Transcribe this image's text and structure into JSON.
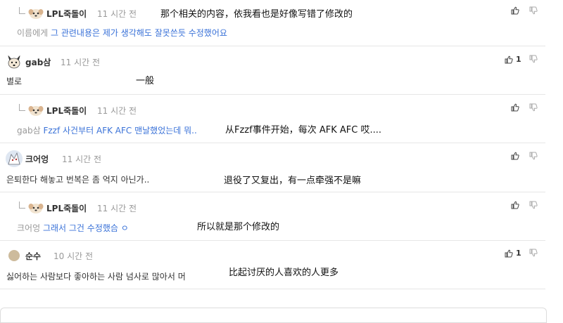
{
  "comments": [
    {
      "author": "LPL죽돌이",
      "time": "11 시간 전",
      "mention": "이름에게",
      "text": "그 관련내용은 제가 생각해도 잘못쓴듯 수정했어요",
      "annotation": "那个相关的内容，依我看也是好像写错了修改的",
      "likes": ""
    },
    {
      "author": "gab삼",
      "time": "11 시간 전",
      "mention": "",
      "text": "별로",
      "annotation": "一般",
      "likes": "1"
    },
    {
      "author": "LPL죽돌이",
      "time": "11 시간 전",
      "mention": "gab삼",
      "text": "Fzzf 사건부터 AFK AFC 맨날했었는데 뭐..",
      "annotation": "从Fzzf事件开始，每次 AFK AFC 哎....",
      "likes": ""
    },
    {
      "author": "크어엉",
      "time": "11 시간 전",
      "mention": "",
      "text": "은퇴한다 해놓고 번복은 좀 억지 아닌가..",
      "annotation": "退役了又复出，有一点牵强不是嘛",
      "likes": ""
    },
    {
      "author": "LPL죽돌이",
      "time": "11 시간 전",
      "mention": "크어엉",
      "text": "그래서 그건 수정했슴 ㅇ",
      "annotation": "所以就是那个修改的",
      "likes": ""
    },
    {
      "author": "순수",
      "time": "10 시간 전",
      "mention": "",
      "text": "싫어하는 사람보다 좋아하는 사람 넘사로 많아서 머",
      "annotation": "比起讨厌的人喜欢的人更多",
      "likes": "1"
    }
  ],
  "icons": {
    "like": "thumbs-up-icon",
    "dislike": "thumbs-down-icon"
  },
  "colors": {
    "reply_link": "#3a72d8",
    "meta": "#999999",
    "divider": "#e6e6e6"
  }
}
